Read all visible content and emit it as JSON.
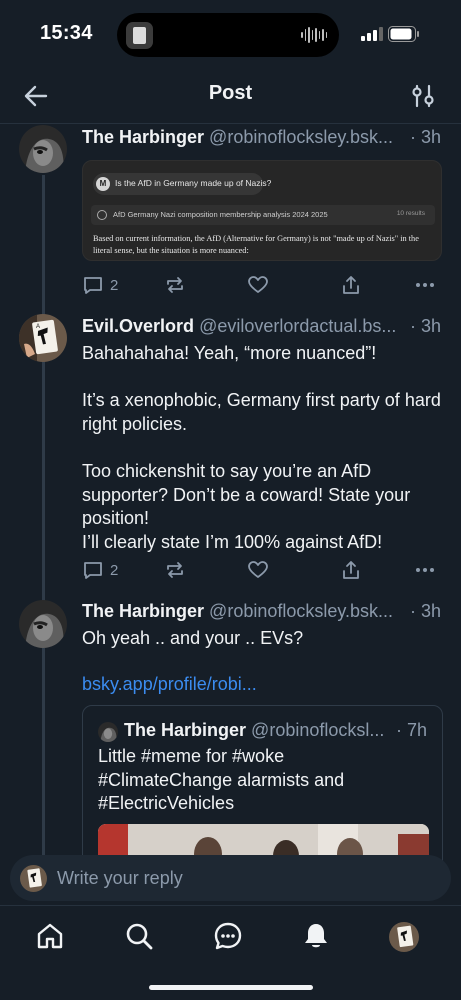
{
  "status_bar": {
    "time": "15:34"
  },
  "header": {
    "title": "Post"
  },
  "posts": [
    {
      "name": "The Harbinger",
      "handle": "@robinoflocksley.bsk...",
      "time": "· 3h",
      "embed": {
        "question": "Is the AfD in Germany made up of Nazis?",
        "search_label": "AfD Germany Nazi composition membership analysis 2024 2025",
        "results": "10 results",
        "answer": "Based on current information, the AfD (Alternative for Germany) is not \"made up of Nazis\" in the literal sense, but the situation is more nuanced:"
      },
      "replies": "2"
    },
    {
      "name": "Evil.Overlord",
      "handle": "@eviloverlordactual.bs...",
      "time": "· 3h",
      "text": "Bahahahaha! Yeah, “more nuanced”!\n\nIt’s a xenophobic, Germany first party of hard right policies.\n\nToo chickenshit to say you’re an AfD supporter?  Don’t be a coward!  State your position!\nI’ll clearly state I’m 100% against AfD!",
      "replies": "2"
    },
    {
      "name": "The Harbinger",
      "handle": "@robinoflocksley.bsk...",
      "time": "· 3h",
      "text": "Oh yeah .. and your .. EVs?",
      "link": "bsky.app/profile/robi...",
      "quote": {
        "name": "The Harbinger",
        "handle": "@robinoflocksl...",
        "time": "· 7h",
        "text": "Little #meme for #woke\n#ClimateChange alarmists and\n#ElectricVehicles"
      }
    }
  ],
  "reply_bar": {
    "placeholder": "Write your reply"
  },
  "colors": {
    "background": "#161e27",
    "accent_link": "#3b8cf0",
    "muted_text": "#8c9aab"
  },
  "icons": [
    "back-arrow-icon",
    "settings-sliders-icon",
    "reply-icon",
    "repost-icon",
    "like-icon",
    "share-icon",
    "more-icon",
    "home-icon",
    "search-icon",
    "chat-icon",
    "bell-icon"
  ]
}
